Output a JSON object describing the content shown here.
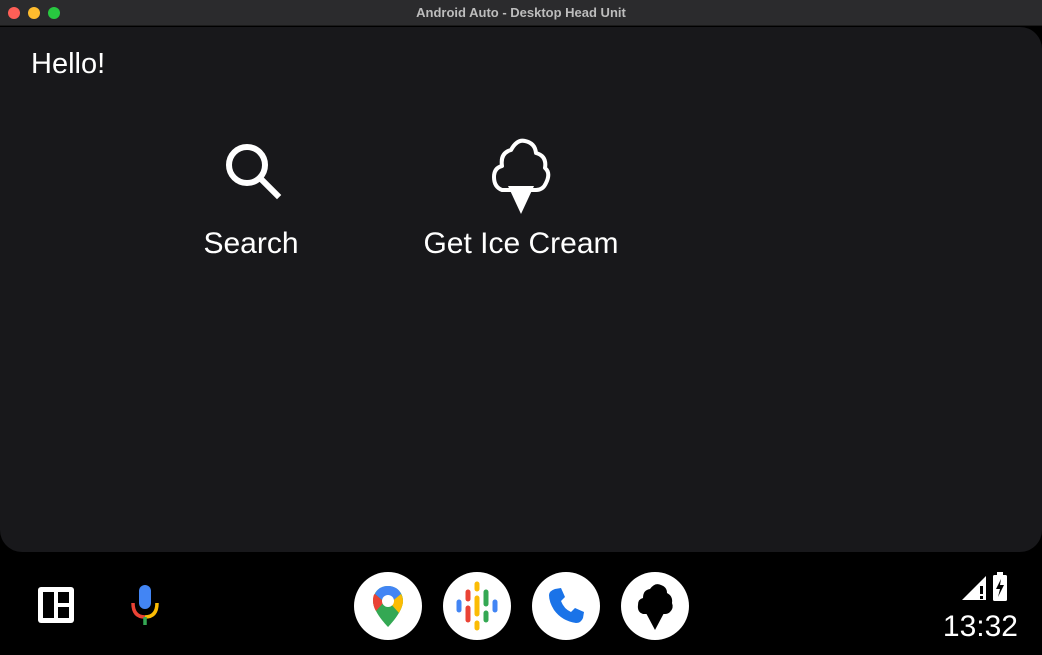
{
  "window": {
    "title": "Android Auto - Desktop Head Unit"
  },
  "screen": {
    "title": "Hello!",
    "items": [
      {
        "label": "Search",
        "icon": "search-icon"
      },
      {
        "label": "Get Ice Cream",
        "icon": "ice-cream-icon"
      }
    ]
  },
  "rail": {
    "left_buttons": [
      {
        "icon": "dashboard-layout-icon"
      },
      {
        "icon": "microphone-icon"
      }
    ],
    "apps": [
      {
        "icon": "google-maps-icon"
      },
      {
        "icon": "podcasts-icon"
      },
      {
        "icon": "phone-icon"
      },
      {
        "icon": "ice-cream-app-icon"
      }
    ],
    "status": {
      "time": "13:32",
      "signal_icon": "cell-signal-icon",
      "battery_icon": "battery-charging-icon"
    }
  },
  "colors": {
    "surface": "#18181b",
    "rail": "#000000",
    "text": "#ffffff",
    "maps_red": "#ea4335",
    "maps_blue": "#4285f4",
    "maps_green": "#34a853",
    "maps_yellow": "#fbbc04",
    "phone_blue": "#1a73e8"
  }
}
